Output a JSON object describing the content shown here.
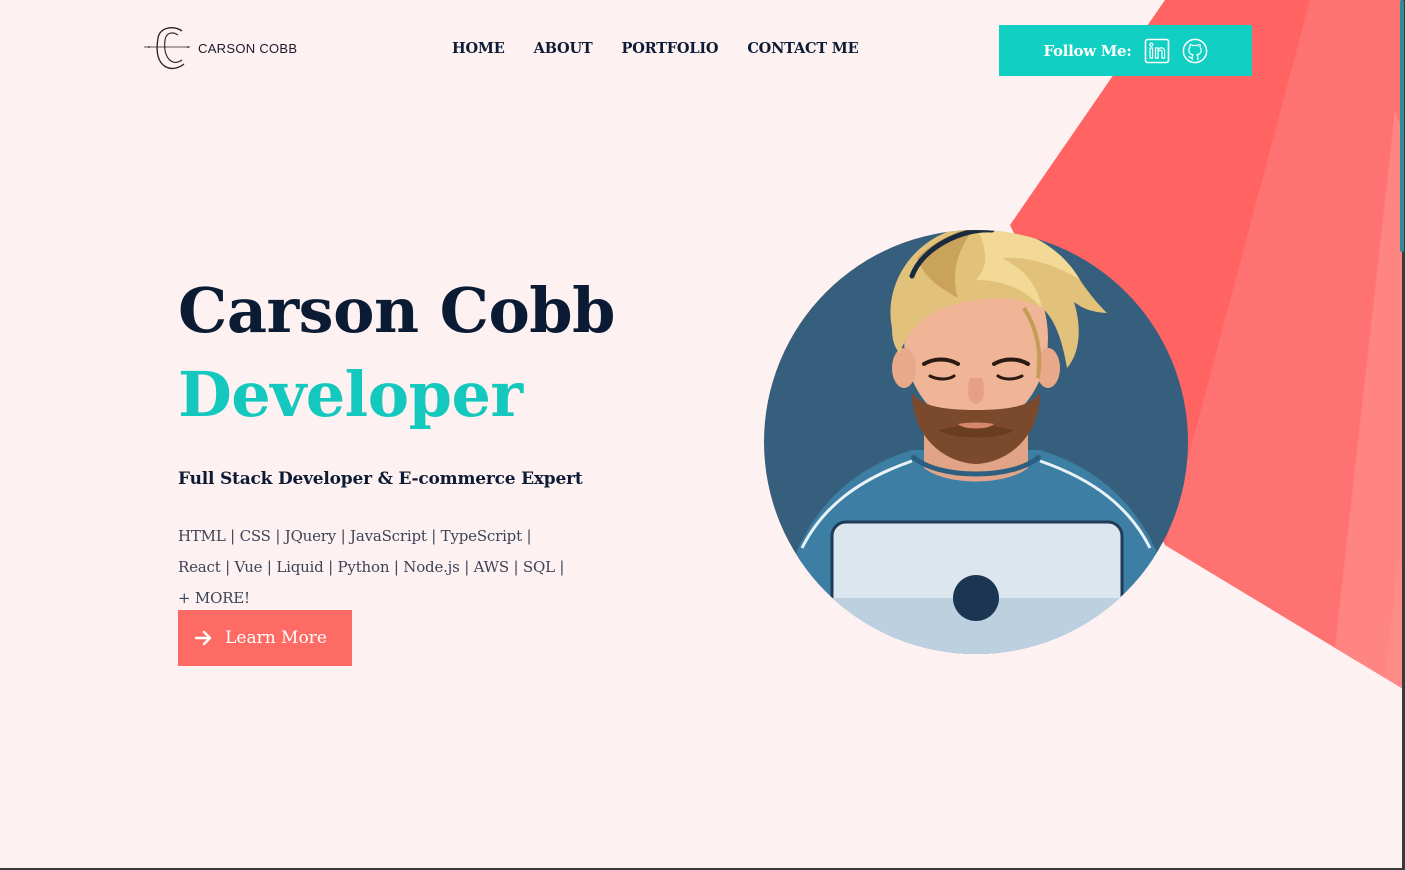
{
  "header": {
    "logo_text": "CARSON COBB",
    "nav": [
      {
        "label": "HOME"
      },
      {
        "label": "ABOUT"
      },
      {
        "label": "PORTFOLIO"
      },
      {
        "label": "CONTACT ME"
      }
    ],
    "follow": {
      "label": "Follow Me:",
      "icons": [
        "linkedin-icon",
        "github-icon"
      ]
    }
  },
  "hero": {
    "name": "Carson Cobb",
    "role": "Developer",
    "tagline": "Full Stack Developer & E-commerce Expert",
    "skills": "HTML | CSS | JQuery | JavaScript | TypeScript | React | Vue | Liquid | Python | Node.js | AWS | SQL | + MORE!",
    "cta_label": "Learn More"
  },
  "colors": {
    "background": "#fdf1f1",
    "accent_teal": "#11cfc2",
    "accent_coral": "#fe6a64",
    "text_dark": "#0d1b34"
  }
}
